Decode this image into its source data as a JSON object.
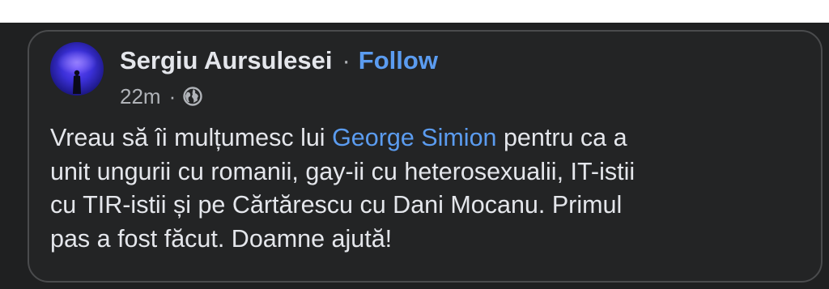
{
  "post": {
    "author": "Sergiu Aursulesei",
    "separator": "·",
    "follow_label": "Follow",
    "timestamp": "22m",
    "meta_separator": "·",
    "privacy_icon": "globe-icon",
    "body": {
      "line1_before": "Vreau să îi mulțumesc lui ",
      "mention": "George Simion",
      "line1_after": " pentru ca a",
      "line2": "unit ungurii cu romanii, gay-ii cu heterosexualii, IT-istii",
      "line3": "cu TIR-istii și pe Cărtărescu cu Dani Mocanu. Primul",
      "line4": "pas a fost făcut. Doamne ajută!"
    }
  },
  "colors": {
    "background": "#1f2021",
    "card": "#232425",
    "card_border": "#4a4b4d",
    "text": "#e4e6eb",
    "secondary_text": "#b0b3b8",
    "link": "#5b9cf0"
  }
}
